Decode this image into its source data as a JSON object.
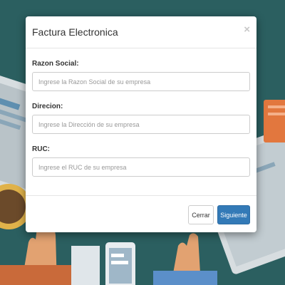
{
  "modal": {
    "title": "Factura Electronica",
    "close_label": "×"
  },
  "form": {
    "fields": [
      {
        "label": "Razon Social:",
        "placeholder": "Ingrese la Razon Social de su empresa",
        "value": ""
      },
      {
        "label": "Direcion:",
        "placeholder": "Ingrese la Dirección de su empresa",
        "value": ""
      },
      {
        "label": "RUC:",
        "placeholder": "Ingrese el RUC de su empresa",
        "value": ""
      }
    ]
  },
  "footer": {
    "cancel_label": "Cerrar",
    "next_label": "Siguiente"
  },
  "colors": {
    "backdrop": "#2b5f60",
    "primary_button": "#337ab7"
  }
}
